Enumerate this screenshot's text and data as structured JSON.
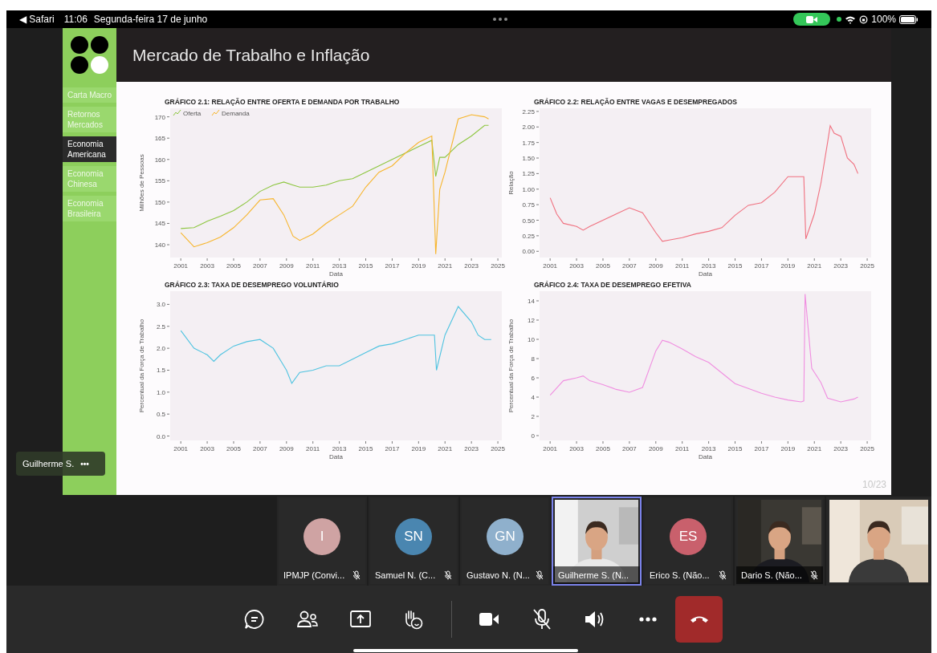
{
  "status_bar": {
    "back": "◀ Safari",
    "time": "11:06",
    "date": "Segunda-feira 17 de junho",
    "battery": "100%"
  },
  "slide": {
    "title": "Mercado de Trabalho e Inflação",
    "nav": [
      {
        "label": "Carta Macro",
        "selected": false
      },
      {
        "label": "Retornos Mercados",
        "selected": false
      },
      {
        "label": "Economia Americana",
        "selected": true
      },
      {
        "label": "Economia Chinesa",
        "selected": false
      },
      {
        "label": "Economia Brasileira",
        "selected": false
      }
    ],
    "charts": [
      {
        "chart_data": {
          "type": "line",
          "title": "GRÁFICO 2.1: RELAÇÃO ENTRE OFERTA E DEMANDA POR TRABALHO",
          "xlabel": "Data",
          "ylabel": "Milhões de Pessoas",
          "x": [
            2001,
            2002,
            2003,
            2004,
            2005,
            2006,
            2007,
            2008,
            2008.8,
            2009.5,
            2010,
            2011,
            2012,
            2013,
            2014,
            2015,
            2016,
            2017,
            2018,
            2019,
            2020,
            2020.3,
            2020.6,
            2021,
            2022,
            2023,
            2024,
            2024.3
          ],
          "series": [
            {
              "name": "Oferta",
              "color": "#8dc63f",
              "values": [
                143.8,
                144,
                145.5,
                146.7,
                148,
                150,
                152.5,
                154,
                154.7,
                154,
                153.5,
                153.5,
                154,
                155,
                155.5,
                157,
                158.5,
                160,
                161.5,
                163,
                164.5,
                156,
                160.5,
                160.5,
                163.5,
                165.5,
                168,
                168
              ]
            },
            {
              "name": "Demanda",
              "color": "#f7b52c",
              "values": [
                142.8,
                139.5,
                140.5,
                141.8,
                144,
                147,
                150.5,
                150.8,
                147,
                142,
                141,
                142.5,
                145,
                147,
                149,
                153.5,
                157,
                158.5,
                161.5,
                164,
                165.5,
                137.8,
                153,
                157,
                169.5,
                170.5,
                170,
                169.5
              ]
            }
          ],
          "legend": true,
          "xlim": [
            2000.2,
            2025.3
          ],
          "ylim": [
            137,
            172
          ],
          "xticks": [
            2001,
            2003,
            2005,
            2007,
            2009,
            2011,
            2013,
            2015,
            2017,
            2019,
            2021,
            2023,
            2025
          ],
          "yticks": [
            140,
            145,
            150,
            155,
            160,
            165,
            170
          ]
        }
      },
      {
        "chart_data": {
          "type": "line",
          "title": "GRÁFICO 2.2: RELAÇÃO ENTRE VAGAS E DESEMPREGADOS",
          "xlabel": "Data",
          "ylabel": "Relação",
          "x": [
            2001,
            2001.5,
            2002,
            2003,
            2003.5,
            2004,
            2005,
            2006,
            2007,
            2008,
            2009,
            2009.5,
            2010,
            2011,
            2012,
            2013,
            2014,
            2015,
            2016,
            2017,
            2018,
            2019,
            2020,
            2020.2,
            2020.35,
            2021,
            2021.5,
            2022,
            2022.2,
            2022.5,
            2023,
            2023.5,
            2024,
            2024.3
          ],
          "series": [
            {
              "color": "#f0707f",
              "values": [
                0.86,
                0.6,
                0.45,
                0.4,
                0.34,
                0.4,
                0.5,
                0.6,
                0.7,
                0.62,
                0.3,
                0.16,
                0.18,
                0.22,
                0.28,
                0.32,
                0.38,
                0.58,
                0.74,
                0.78,
                0.95,
                1.2,
                1.2,
                1.2,
                0.2,
                0.6,
                1.1,
                1.75,
                2.02,
                1.9,
                1.85,
                1.5,
                1.4,
                1.25
              ]
            }
          ],
          "xlim": [
            2000.2,
            2025.3
          ],
          "ylim": [
            -0.1,
            2.3
          ],
          "xticks": [
            2001,
            2003,
            2005,
            2007,
            2009,
            2011,
            2013,
            2015,
            2017,
            2019,
            2021,
            2023,
            2025
          ],
          "yticks": [
            {
              "value": 0,
              "label": "0.00"
            },
            {
              "value": 0.25,
              "label": "0.25"
            },
            {
              "value": 0.5,
              "label": "0.50"
            },
            {
              "value": 0.75,
              "label": "0.75"
            },
            {
              "value": 1,
              "label": "1.00"
            },
            {
              "value": 1.25,
              "label": "1.25"
            },
            {
              "value": 1.5,
              "label": "1.50"
            },
            {
              "value": 1.75,
              "label": "1.75"
            },
            {
              "value": 2,
              "label": "2.00"
            },
            {
              "value": 2.25,
              "label": "2.25"
            }
          ]
        }
      },
      {
        "chart_data": {
          "type": "line",
          "title": "GRÁFICO 2.3: TAXA DE DESEMPREGO VOLUNTÁRIO",
          "xlabel": "Data",
          "ylabel": "Percentual da Força de Trabalho",
          "x": [
            2001,
            2002,
            2003,
            2003.5,
            2004,
            2005,
            2006,
            2007,
            2008,
            2009,
            2009.4,
            2010,
            2011,
            2012,
            2013,
            2014,
            2015,
            2016,
            2017,
            2018,
            2019,
            2020,
            2020.2,
            2020.35,
            2021,
            2022,
            2023,
            2023.5,
            2024,
            2024.5
          ],
          "series": [
            {
              "color": "#4ec3e0",
              "values": [
                2.4,
                2.0,
                1.85,
                1.7,
                1.85,
                2.05,
                2.15,
                2.2,
                2.0,
                1.5,
                1.2,
                1.45,
                1.5,
                1.6,
                1.6,
                1.75,
                1.9,
                2.05,
                2.1,
                2.2,
                2.3,
                2.3,
                2.3,
                1.5,
                2.3,
                2.95,
                2.6,
                2.3,
                2.2,
                2.2
              ]
            }
          ],
          "xlim": [
            2000.2,
            2025.3
          ],
          "ylim": [
            -0.1,
            3.3
          ],
          "xticks": [
            2001,
            2003,
            2005,
            2007,
            2009,
            2011,
            2013,
            2015,
            2017,
            2019,
            2021,
            2023,
            2025
          ],
          "yticks": [
            {
              "value": 0,
              "label": "0.0"
            },
            {
              "value": 0.5,
              "label": "0.5"
            },
            {
              "value": 1,
              "label": "1.0"
            },
            {
              "value": 1.5,
              "label": "1.5"
            },
            {
              "value": 2,
              "label": "2.0"
            },
            {
              "value": 2.5,
              "label": "2.5"
            },
            {
              "value": 3,
              "label": "3.0"
            }
          ]
        }
      },
      {
        "chart_data": {
          "type": "line",
          "title": "GRÁFICO 2.4: TAXA DE DESEMPREGO EFETIVA",
          "xlabel": "Data",
          "ylabel": "Percentual da Força de Trabalho",
          "x": [
            2001,
            2002,
            2003,
            2003.5,
            2004,
            2005,
            2006,
            2007,
            2008,
            2009,
            2009.5,
            2010,
            2011,
            2012,
            2013,
            2014,
            2015,
            2016,
            2017,
            2018,
            2019,
            2020,
            2020.2,
            2020.3,
            2020.8,
            2021.5,
            2022,
            2023,
            2024,
            2024.3
          ],
          "series": [
            {
              "color": "#f08ee0",
              "values": [
                4.2,
                5.7,
                6.0,
                6.2,
                5.7,
                5.3,
                4.8,
                4.5,
                5.0,
                8.8,
                9.9,
                9.7,
                9.0,
                8.2,
                7.6,
                6.5,
                5.4,
                4.9,
                4.4,
                4.0,
                3.7,
                3.5,
                3.6,
                14.7,
                7,
                5.5,
                3.9,
                3.5,
                3.8,
                4
              ]
            }
          ],
          "xlim": [
            2000.2,
            2025.3
          ],
          "ylim": [
            -0.5,
            15
          ],
          "xticks": [
            2001,
            2003,
            2005,
            2007,
            2009,
            2011,
            2013,
            2015,
            2017,
            2019,
            2021,
            2023,
            2025
          ],
          "yticks": [
            0,
            2,
            4,
            6,
            8,
            10,
            12,
            14
          ]
        }
      }
    ],
    "page": "10/23"
  },
  "presenter_label": {
    "name": "Guilherme S.",
    "menu": "•••"
  },
  "participants": [
    {
      "kind": "avatar",
      "initials": "I",
      "color": "#cfa3a3",
      "name": "IPMJP (Convi...",
      "muted": true,
      "selected": false
    },
    {
      "kind": "avatar",
      "initials": "SN",
      "color": "#4a86b0",
      "name": "Samuel N. (C...",
      "muted": true,
      "selected": false
    },
    {
      "kind": "avatar",
      "initials": "GN",
      "color": "#8fb0cc",
      "name": "Gustavo N. (N...",
      "muted": true,
      "selected": false
    },
    {
      "kind": "video",
      "name": "Guilherme S. (N...",
      "muted": false,
      "selected": true
    },
    {
      "kind": "avatar",
      "initials": "ES",
      "color": "#c9606c",
      "name": "Erico S. (Não...",
      "muted": true,
      "selected": false
    },
    {
      "kind": "video",
      "name": "Dario S. (Não...",
      "muted": true,
      "selected": false
    },
    {
      "kind": "video",
      "selected": false
    }
  ]
}
